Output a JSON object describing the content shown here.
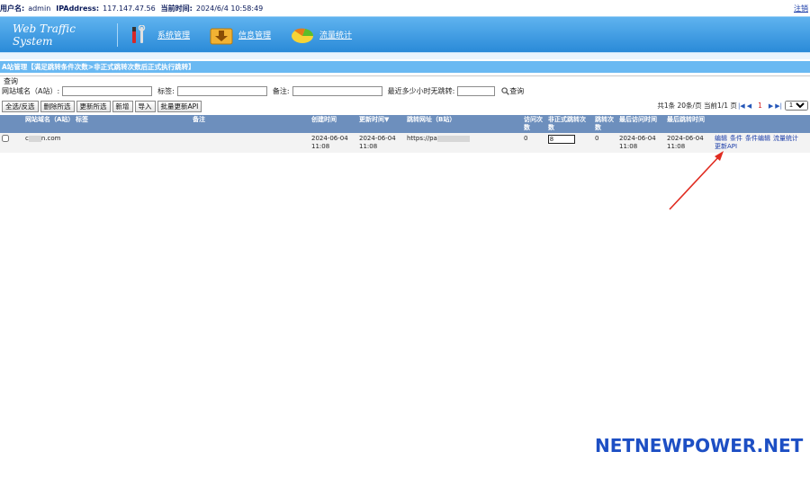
{
  "topbar": {
    "user_label": "用户名:",
    "user_value": "admin",
    "ip_label": "IPAddress:",
    "ip_value": "117.147.47.56",
    "time_label": "当前时间:",
    "time_value": "2024/6/4 10:58:49",
    "logout": "注销"
  },
  "header": {
    "brand": "Web Traffic System",
    "nav": [
      {
        "label": "系统管理",
        "icon": "tools-icon"
      },
      {
        "label": "信息管理",
        "icon": "download-folder-icon"
      },
      {
        "label": "流量统计",
        "icon": "pie-chart-icon"
      }
    ]
  },
  "path": "A站管理【满足跳转条件次数>非正式跳转次数后正式执行跳转】",
  "query": {
    "title": "查询",
    "domain_label": "网站域名（A站）:",
    "tag_label": "标签:",
    "note_label": "备注:",
    "recent_label": "最近多少小时无跳转:",
    "search_label": "查询"
  },
  "toolbar": {
    "buttons": [
      "全选/反选",
      "删除所选",
      "更新所选",
      "新增",
      "导入",
      "批量更新API"
    ],
    "pager_prefix": "共1条 20条/页 当前1/1 页",
    "current_page": "1",
    "page_select": "1"
  },
  "table": {
    "headers": [
      "网站域名（A站）",
      "标签",
      "备注",
      "创建时间",
      "更新时间▼",
      "跳转网址（B站）",
      "访问次数",
      "非正式跳转次数",
      "跳转次数",
      "最后访问时间",
      "最后跳转时间",
      ""
    ],
    "rows": [
      {
        "domain_prefix": "c",
        "domain_suffix": "n.com",
        "tag": "",
        "note": "",
        "created": "2024-06-04 11:08",
        "updated": "2024-06-04 11:08",
        "jump_url": "https://pa",
        "visits": "0",
        "informal_jumps": "8",
        "jumps": "0",
        "last_visit": "2024-06-04 11:08",
        "last_jump": "2024-06-04 11:08",
        "actions": [
          "编辑",
          "条件",
          "条件编辑",
          "流量统计",
          "更新API"
        ]
      }
    ]
  },
  "watermark": "NETNEWPOWER.NET",
  "colors": {
    "header_blue": "#2a8ad8",
    "table_header": "#6d8fbd",
    "arrow_red": "#e02b20"
  }
}
